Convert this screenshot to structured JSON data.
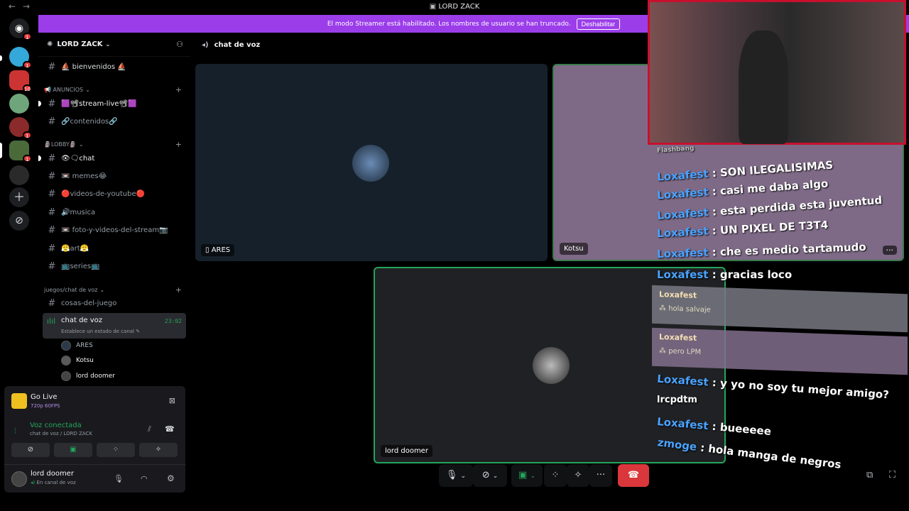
{
  "window": {
    "title": "LORD ZACK"
  },
  "banner": {
    "text": "El modo Streamer está habilitado. Los nombres de usuario se han truncado.",
    "button": "Deshabilitar"
  },
  "servers": [
    {
      "badge": "1"
    },
    {
      "badge": "1"
    },
    {
      "badge": "10"
    },
    {
      "badge": ""
    },
    {
      "badge": "1"
    },
    {
      "badge": "1"
    },
    {
      "badge": ""
    }
  ],
  "server": {
    "name": "LORD ZACK"
  },
  "channels": {
    "bienvenidos": "⛵ bienvenidos ⛵",
    "cat_anuncios": "📢 ANUNCIOS",
    "stream_live": "🟪📽stream-live📽🟪",
    "contenidos": "🔗contenidos🔗",
    "cat_lobby": "🗿LOBBY🗿",
    "chat": "👁🗨chat",
    "memes": "📼 memes😂",
    "videos": "🔴videos-de-youtube🔴",
    "musica": "🔊musica",
    "foto": "📼 foto-y-videos-del-stream📷",
    "art": "😤art😤",
    "series": "📺series📺",
    "cat_juegos": "juegos/chat de voz",
    "cosas": "cosas-del-juego",
    "voice_name": "chat de voz",
    "voice_status": "Establece un estado de canal",
    "voice_time": "23:02"
  },
  "voice_users": [
    "ARES",
    "Kotsu",
    "lord doomer"
  ],
  "panel": {
    "golive_title": "Go Live",
    "golive_sub": "720p 60FPS",
    "voice_title": "Voz conectada",
    "voice_sub": "chat de voz / LORD ZACK",
    "username": "lord doomer",
    "user_status": "En canal de voz"
  },
  "main": {
    "channel": "chat de voz"
  },
  "tiles": {
    "ares": "ARES",
    "kotsu": "Kotsu",
    "doomer": "lord doomer"
  },
  "overlay": {
    "top_fragment": "Flashbang",
    "messages": [
      {
        "name": "Loxafest",
        "text": " : SON ILEGALISIMAS"
      },
      {
        "name": "Loxafest",
        "text": " : casi me daba algo"
      },
      {
        "name": "Loxafest",
        "text": " : esta perdida esta juventud"
      },
      {
        "name": "Loxafest",
        "text": " : UN PIXEL DE T3T4"
      },
      {
        "name": "Loxafest",
        "text": " : che es medio tartamudo"
      },
      {
        "name": "Loxafest",
        "text": " : gracias loco"
      }
    ],
    "cards": [
      {
        "name": "Loxafest",
        "text": "hola salvaje"
      },
      {
        "name": "Loxafest",
        "text": "pero LPM"
      }
    ],
    "bottom": [
      {
        "name": "Loxafest",
        "text": " : y yo no soy tu mejor amigo?"
      },
      {
        "name": "",
        "text": "lrcpdtm"
      },
      {
        "name": "Loxafest",
        "text": " : bueeeee"
      },
      {
        "name": "zmoge",
        "text": " : hola manga de negros"
      }
    ]
  }
}
